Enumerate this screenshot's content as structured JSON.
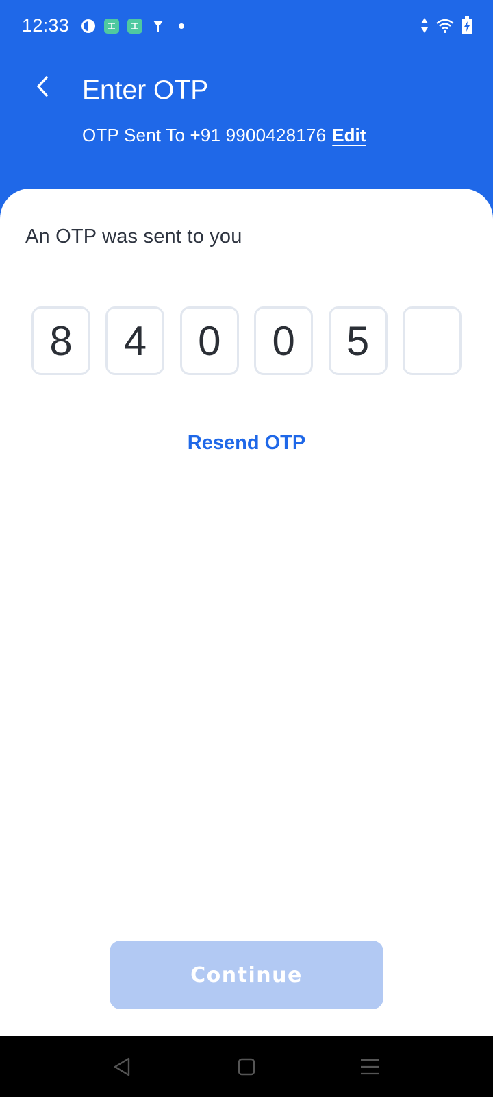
{
  "status_bar": {
    "time": "12:33",
    "left_icons": [
      "pie-app-icon",
      "app-notification-icon",
      "app-notification-icon",
      "vpn-key-icon",
      "dot-icon"
    ],
    "right_icons": [
      "data-arrows-icon",
      "wifi-icon",
      "battery-charging-icon"
    ]
  },
  "header": {
    "title": "Enter OTP",
    "otp_sent_text": "OTP Sent To +91 9900428176",
    "edit_label": "Edit"
  },
  "card": {
    "heading": "An OTP was sent to you",
    "otp_digits": [
      "8",
      "4",
      "0",
      "0",
      "5",
      ""
    ],
    "resend_label": "Resend OTP",
    "continue_label": "Continue"
  },
  "colors": {
    "brand": "#1f68e8",
    "continue_disabled": "#b2c9f3",
    "box_border": "#e2e7ef"
  },
  "nav_bar": {
    "buttons": [
      "back-icon",
      "home-icon",
      "menu-icon"
    ]
  }
}
